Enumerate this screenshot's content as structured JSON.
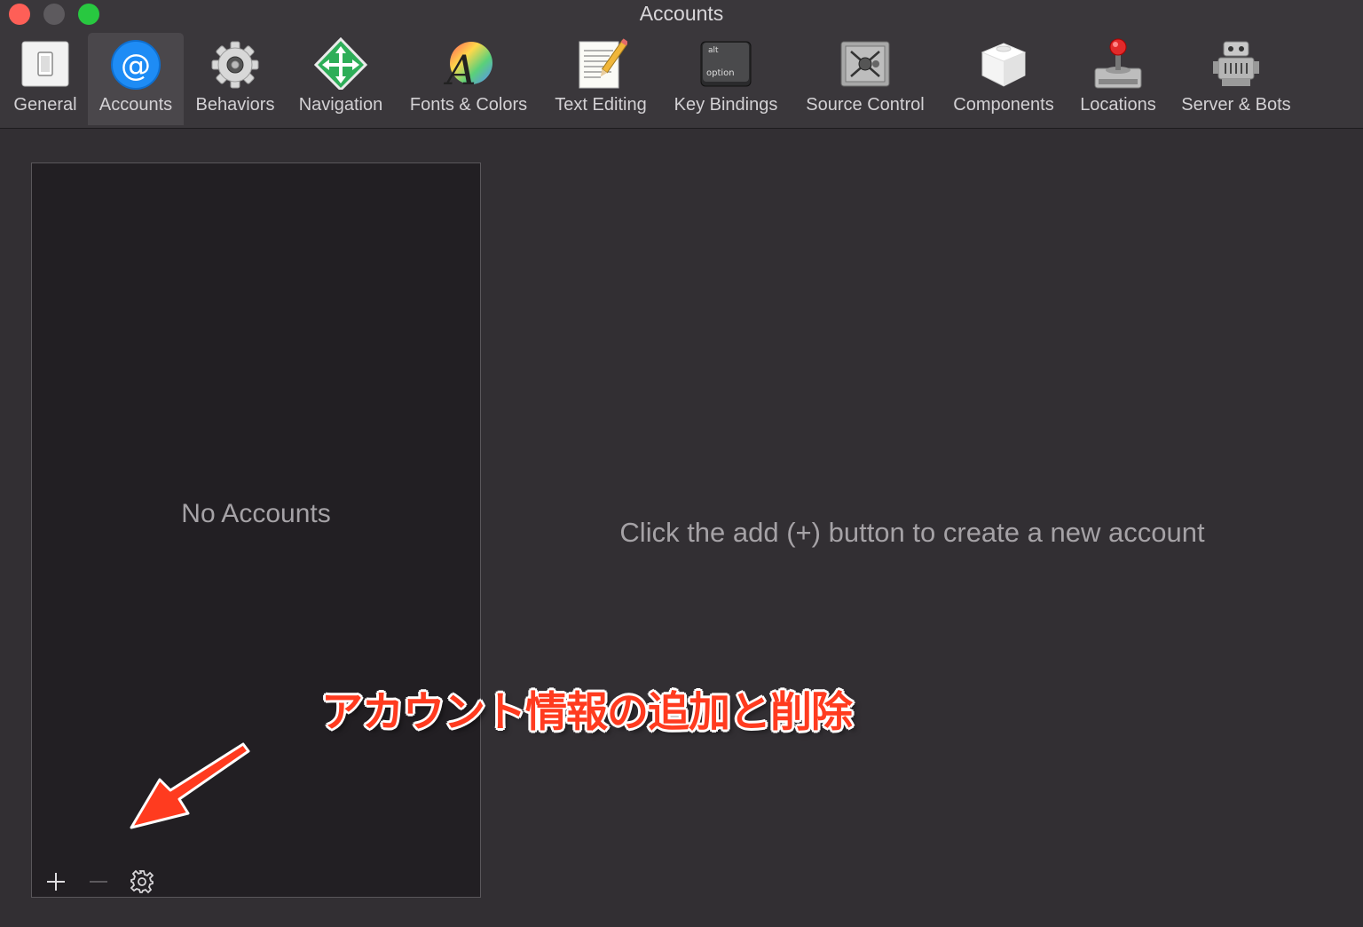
{
  "window": {
    "title": "Accounts",
    "traffic_lights": {
      "close": "#fe5f57",
      "minimize": "#5d5a5e",
      "zoom": "#28c840"
    }
  },
  "toolbar": {
    "active_tab": "Accounts",
    "tabs": [
      {
        "label": "General",
        "icon": "switch-icon"
      },
      {
        "label": "Accounts",
        "icon": "at-sign-icon"
      },
      {
        "label": "Behaviors",
        "icon": "gear-icon"
      },
      {
        "label": "Navigation",
        "icon": "navigation-arrows-icon"
      },
      {
        "label": "Fonts & Colors",
        "icon": "font-color-wheel-icon"
      },
      {
        "label": "Text Editing",
        "icon": "notepad-pencil-icon"
      },
      {
        "label": "Key Bindings",
        "icon": "option-key-icon",
        "key_top": "alt",
        "key_bottom": "option"
      },
      {
        "label": "Source Control",
        "icon": "safe-icon"
      },
      {
        "label": "Components",
        "icon": "component-box-icon"
      },
      {
        "label": "Locations",
        "icon": "joystick-drive-icon"
      },
      {
        "label": "Server & Bots",
        "icon": "robot-icon"
      }
    ]
  },
  "sidebar": {
    "empty_text": "No Accounts",
    "buttons": {
      "add": "+",
      "remove": "—",
      "settings": "gear-icon"
    }
  },
  "detail": {
    "empty_text": "Click the add (+) button to create a new account"
  },
  "annotation": {
    "text": "アカウント情報の追加と削除",
    "color": "#ff3b1f"
  }
}
